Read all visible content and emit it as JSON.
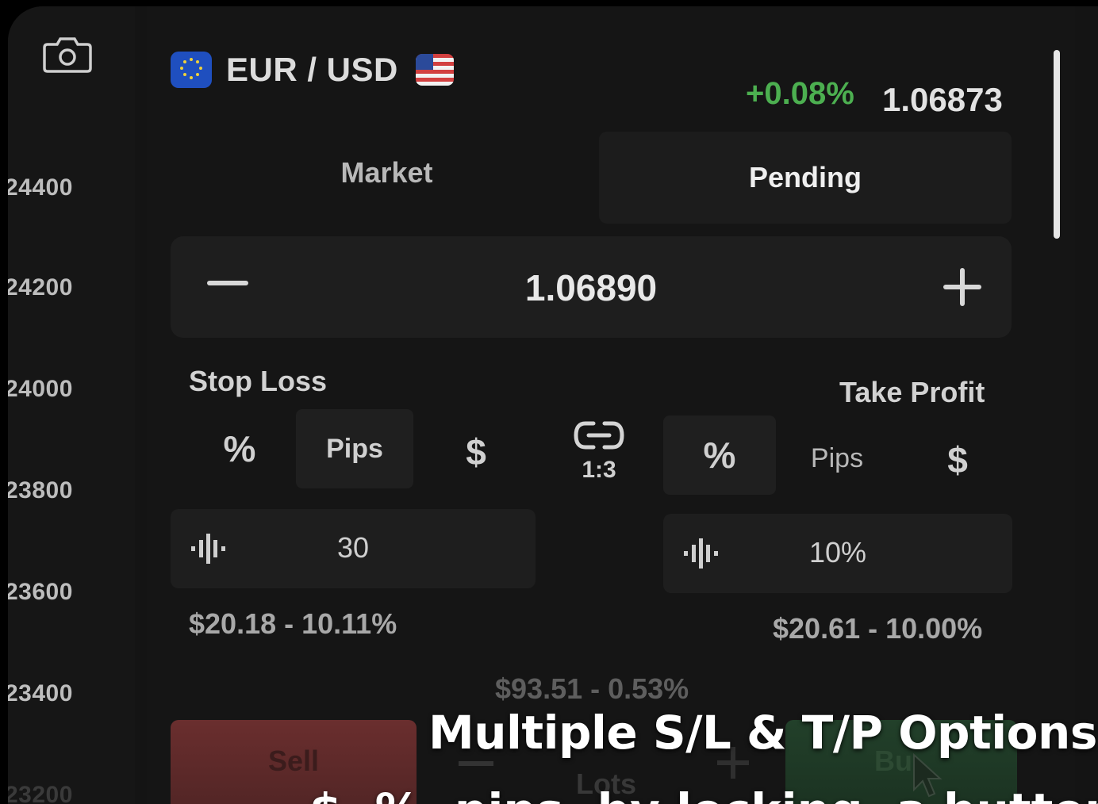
{
  "price_axis": {
    "labels": [
      "24400",
      "24200",
      "24000",
      "23800",
      "23600",
      "23400",
      "23200"
    ]
  },
  "header": {
    "pair": "EUR / USD",
    "change": "+0.08%",
    "price": "1.06873",
    "colors": {
      "positive": "#4caf50"
    }
  },
  "tabs": {
    "market": "Market",
    "pending": "Pending",
    "active": "Pending"
  },
  "price_stepper": {
    "value": "1.06890",
    "minus_icon": "minus-icon",
    "plus_icon": "plus-icon"
  },
  "stop_loss": {
    "title": "Stop Loss",
    "options": [
      "%",
      "Pips",
      "$"
    ],
    "selected": "Pips",
    "value": "30",
    "summary": "$20.18 - 10.11%"
  },
  "link": {
    "ratio": "1:3",
    "icon": "link-icon"
  },
  "take_profit": {
    "title": "Take Profit",
    "options": [
      "%",
      "Pips",
      "$"
    ],
    "selected": "%",
    "value": "10%",
    "summary": "$20.61 - 10.00%"
  },
  "margin_info": "$93.51 - 0.53%",
  "actions": {
    "sell": "Sell",
    "buy": "Bu",
    "lots": "Lots",
    "colors": {
      "sell": "#6a2e2e",
      "buy": "#22402a"
    }
  },
  "caption": {
    "line1": "Multiple S/L & T/P Options",
    "line2": "$, %, pips, by locking, a button"
  }
}
